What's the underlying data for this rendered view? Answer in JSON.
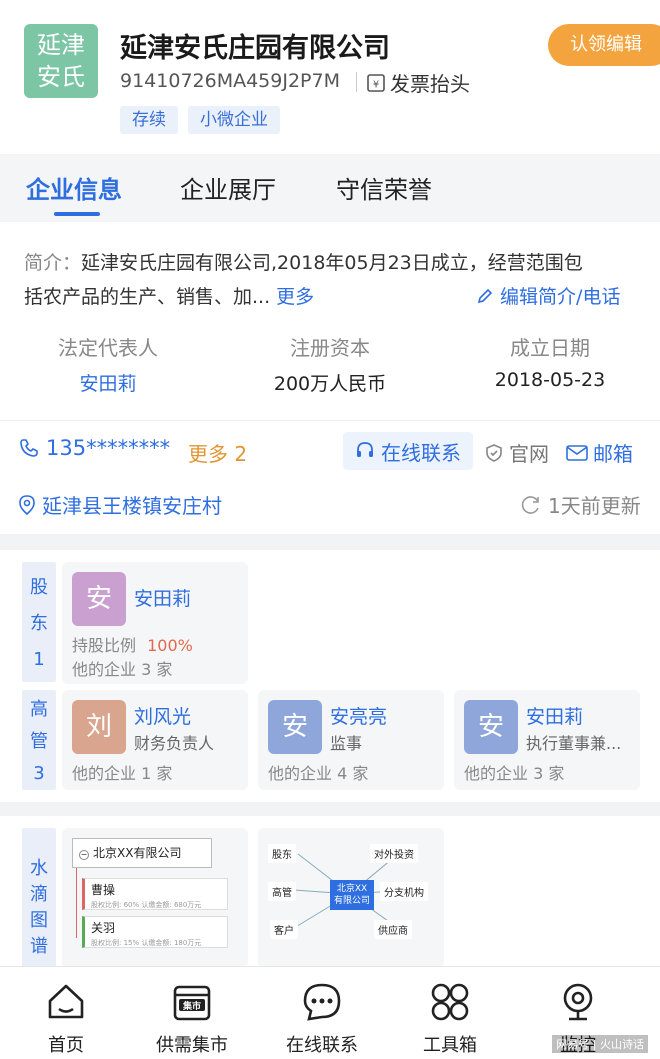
{
  "company": {
    "logo_text_1": "延津",
    "logo_text_2": "安氏",
    "name": "延津安氏庄园有限公司",
    "claim_button": "认领编辑",
    "credit_code": "91410726MA459J2P7M",
    "invoice_label": "发票抬头",
    "tags": [
      "存续",
      "小微企业"
    ]
  },
  "tabs": [
    "企业信息",
    "企业展厅",
    "守信荣誉"
  ],
  "intro": {
    "label": "简介：",
    "text_line1": "延津安氏庄园有限公司,2018年05月23日成立，经营范围包",
    "text_line2": "括农产品的生产、销售、加...",
    "more": "更多",
    "edit": "编辑简介/电话"
  },
  "stats": [
    {
      "key": "法定代表人",
      "value": "安田莉"
    },
    {
      "key": "注册资本",
      "value": "200万人民币"
    },
    {
      "key": "成立日期",
      "value": "2018-05-23"
    }
  ],
  "contact": {
    "phone": "135********",
    "more_phone": "更多 2",
    "online": "在线联系",
    "website": "官网",
    "email": "邮箱",
    "address": "延津县王楼镇安庄村",
    "updated": "1天前更新"
  },
  "shareholders": {
    "side": [
      "股",
      "东",
      "1"
    ],
    "items": [
      {
        "avatar": "安",
        "name": "安田莉",
        "ratio_label": "持股比例",
        "ratio": "100%",
        "other": "他的企业  3 家",
        "color": "#c9a0cf"
      }
    ]
  },
  "executives": {
    "side": [
      "高",
      "管",
      "3"
    ],
    "items": [
      {
        "avatar": "刘",
        "name": "刘风光",
        "role": "财务负责人",
        "other": "他的企业  1 家",
        "color": "#d9a58e"
      },
      {
        "avatar": "安",
        "name": "安亮亮",
        "role": "监事",
        "other": "他的企业  4 家",
        "color": "#8ea6d9"
      },
      {
        "avatar": "安",
        "name": "安田莉",
        "role": "执行董事兼...",
        "other": "他的企业  3 家",
        "color": "#8ea6d9"
      }
    ]
  },
  "graph": {
    "side": [
      "水",
      "滴",
      "图",
      "谱"
    ],
    "equity": {
      "top": "北京XX有限公司",
      "p1_name": "曹操",
      "p1_detail": "股权比例: 60%  认缴金额: 680万元",
      "p2_name": "关羽",
      "p2_detail": "股权比例: 15%  认缴金额: 180万元"
    },
    "relation": {
      "center": "北京XX\n有限公司",
      "nodes": [
        "股东",
        "对外投资",
        "高管",
        "分支机构",
        "客户",
        "供应商"
      ]
    }
  },
  "nav": [
    {
      "label": "首页",
      "icon": "home-icon"
    },
    {
      "label": "供需集市",
      "icon": "market-icon",
      "badge": "集市"
    },
    {
      "label": "在线联系",
      "icon": "chat-icon"
    },
    {
      "label": "工具箱",
      "icon": "toolbox-icon"
    },
    {
      "label": "监控",
      "icon": "camera-icon"
    }
  ],
  "watermark": "网易号 | 火山诗话"
}
